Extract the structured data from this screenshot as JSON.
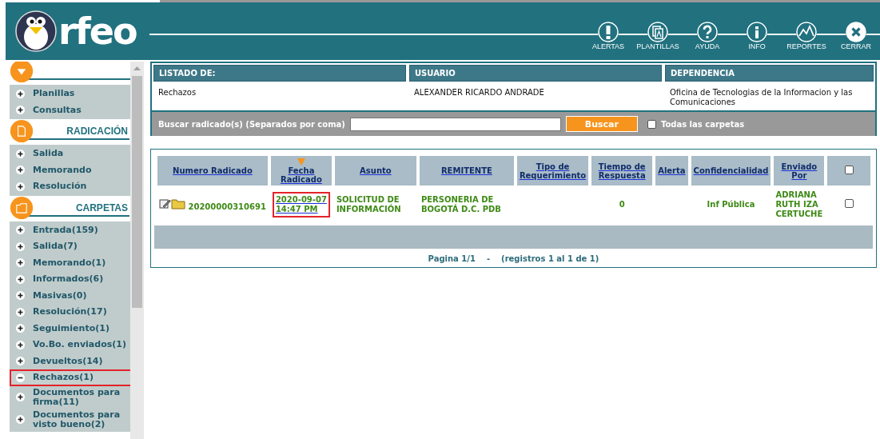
{
  "header": {
    "logo_text": "rfeo",
    "nav": [
      {
        "label": "ALERTAS",
        "kind": "alert"
      },
      {
        "label": "PLANTILLAS",
        "kind": "templates"
      },
      {
        "label": "AYUDA",
        "kind": "help"
      },
      {
        "label": "INFO",
        "kind": "info"
      },
      {
        "label": "REPORTES",
        "kind": "reports"
      },
      {
        "label": "CERRAR",
        "kind": "close"
      }
    ]
  },
  "sidebar": {
    "sections": [
      {
        "kind": "menu",
        "items": [
          {
            "label": "Planillas",
            "selected": false
          },
          {
            "label": "Consultas",
            "selected": false
          }
        ]
      },
      {
        "kind": "document",
        "title": "RADICACIÓN",
        "items": [
          {
            "label": "Salida",
            "selected": false
          },
          {
            "label": "Memorando",
            "selected": false
          },
          {
            "label": "Resolución",
            "selected": false
          }
        ]
      },
      {
        "kind": "folder",
        "title": "CARPETAS",
        "items": [
          {
            "label": "Entrada(159)",
            "selected": false
          },
          {
            "label": "Salida(7)",
            "selected": false
          },
          {
            "label": "Memorando(1)",
            "selected": false
          },
          {
            "label": "Informados(6)",
            "selected": false
          },
          {
            "label": "Masivas(0)",
            "selected": false
          },
          {
            "label": "Resolución(17)",
            "selected": false
          },
          {
            "label": "Seguimiento(1)",
            "selected": false
          },
          {
            "label": "Vo.Bo. enviados(1)",
            "selected": false
          },
          {
            "label": "Devueltos(14)",
            "selected": false
          },
          {
            "label": "Rechazos(1)",
            "selected": true
          },
          {
            "label": "Documentos para firma(11)",
            "selected": false
          },
          {
            "label": "Documentos para visto bueno(2)",
            "selected": false
          }
        ]
      }
    ]
  },
  "info": {
    "columns": [
      {
        "heading": "LISTADO DE:",
        "value": "Rechazos"
      },
      {
        "heading": "USUARIO",
        "value": "ALEXANDER RICARDO ANDRADE"
      },
      {
        "heading": "DEPENDENCIA",
        "value": "Oficina de Tecnologias de la Informacion y las Comunicaciones"
      }
    ]
  },
  "search": {
    "label": "Buscar radicado(s) (Separados por coma)",
    "button": "Buscar",
    "all_folders_label": "Todas las carpetas",
    "all_folders_checked": false
  },
  "table": {
    "columns": [
      {
        "label": "Numero Radicado",
        "sorted": false
      },
      {
        "label": "Fecha Radicado",
        "sorted": true
      },
      {
        "label": "Asunto",
        "sorted": false
      },
      {
        "label": "REMITENTE",
        "sorted": false
      },
      {
        "label": "Tipo de Requerimiento",
        "sorted": false
      },
      {
        "label": "Tiempo de Respuesta",
        "sorted": false
      },
      {
        "label": "Alerta",
        "sorted": false
      },
      {
        "label": "Confidencialidad",
        "sorted": false
      },
      {
        "label": "Enviado Por",
        "sorted": false
      }
    ],
    "select_all_checked": false,
    "rows": [
      {
        "number": "20200000310691",
        "date": "2020-09-07 14:47 PM",
        "date_highlighted": true,
        "subject": "SOLICITUD DE INFORMACIÓN",
        "sender": "PERSONERIA DE BOGOTÁ D.C. PDB",
        "request_type": "",
        "response_time": "0",
        "alert": "",
        "confidentiality": "Inf Pública",
        "sent_by": "ADRIANA RUTH IZA CERTUCHE",
        "checked": false
      }
    ]
  },
  "pagination": {
    "page": "Pagina 1/1",
    "separator": "-",
    "records": "(registros 1 al 1 de 1)"
  }
}
